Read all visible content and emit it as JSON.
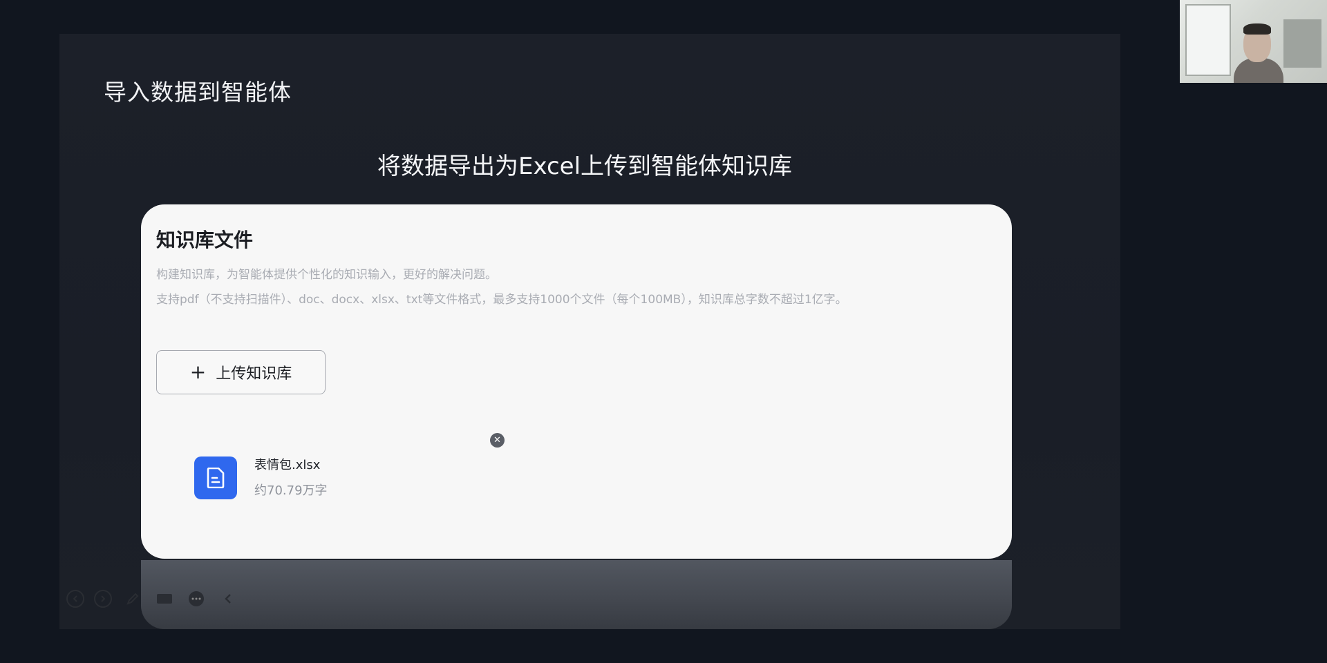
{
  "slide": {
    "title": "导入数据到智能体",
    "subtitle": "将数据导出为Excel上传到智能体知识库"
  },
  "knowledge_base": {
    "title": "知识库文件",
    "description_line1": "构建知识库，为智能体提供个性化的知识输入，更好的解决问题。",
    "description_line2": "支持pdf（不支持扫描件）、doc、docx、xlsx、txt等文件格式，最多支持1000个文件（每个100MB），知识库总字数不超过1亿字。",
    "upload_button": {
      "icon": "plus-icon",
      "label": "上传知识库"
    },
    "file": {
      "name": "表情包.xlsx",
      "meta": "约70.79万字",
      "icon": "document-icon",
      "remove_icon": "close-circle-icon"
    }
  },
  "toolbar": {
    "items": [
      "previous-icon",
      "next-icon",
      "pen-icon",
      "screen-icon",
      "more-icon",
      "collapse-icon"
    ]
  },
  "colors": {
    "background": "#11161f",
    "slide": "#1c2029",
    "card": "#f7f7f7",
    "file_icon": "#2f68ee"
  }
}
